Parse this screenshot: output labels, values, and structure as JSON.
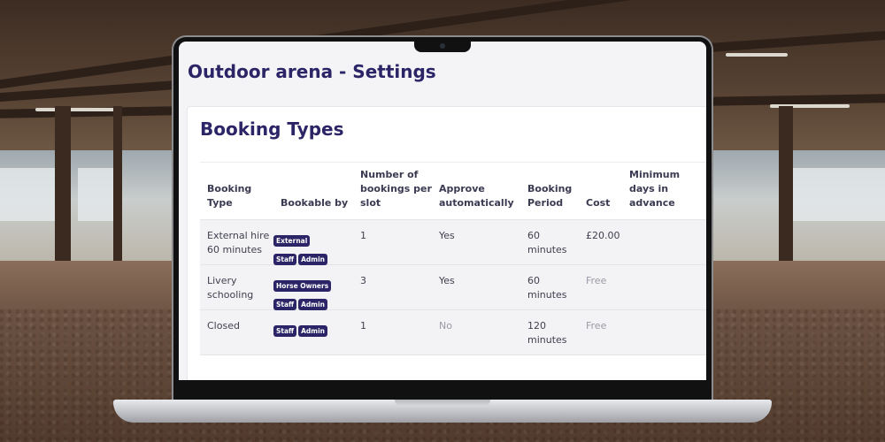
{
  "page": {
    "title": "Outdoor arena - Settings"
  },
  "card": {
    "title": "Booking Types"
  },
  "table": {
    "headers": {
      "booking_type": "Booking Type",
      "bookable_by": "Bookable by",
      "bookings_per_slot": "Number of bookings per slot",
      "approve": "Approve automatically",
      "period": "Booking Period",
      "cost": "Cost",
      "min_days": "Minimum days in advance"
    },
    "rows": [
      {
        "booking_type": "External hire 60 minutes",
        "bookable_by": [
          "External",
          "Staff",
          "Admin"
        ],
        "bookings_per_slot": "1",
        "approve": "Yes",
        "period": "60 minutes",
        "cost": "£20.00",
        "min_days": ""
      },
      {
        "booking_type": "Livery schooling",
        "bookable_by": [
          "Horse Owners",
          "Staff",
          "Admin"
        ],
        "bookings_per_slot": "3",
        "approve": "Yes",
        "period": "60 minutes",
        "cost": "Free",
        "min_days": ""
      },
      {
        "booking_type": "Closed",
        "bookable_by": [
          "Staff",
          "Admin"
        ],
        "bookings_per_slot": "1",
        "approve": "No",
        "period": "120 minutes",
        "cost": "Free",
        "min_days": ""
      }
    ]
  },
  "colors": {
    "brand": "#2b2466",
    "muted_text": "#9a9aa6",
    "row_bg": "#f3f3f5"
  }
}
